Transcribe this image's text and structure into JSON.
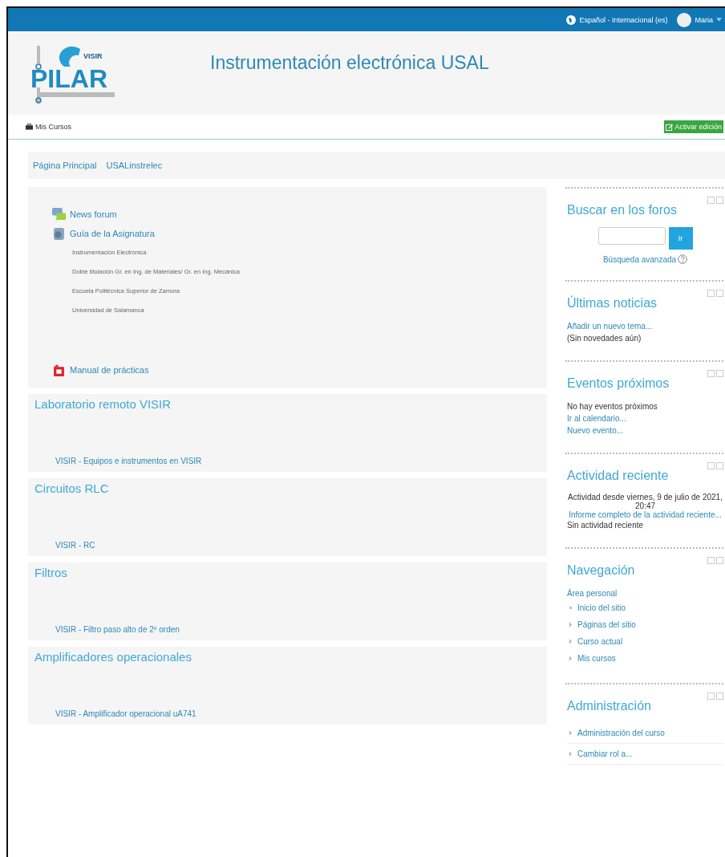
{
  "topbar": {
    "language": "Español - Internacional (es)",
    "user": "Maria"
  },
  "header": {
    "logo_text": "PILAR",
    "logo_badge": "VISIR",
    "title": "Instrumentación electrónica USAL"
  },
  "navbar": {
    "my_courses": "Mis Cursos",
    "edit_button": "Activar edición"
  },
  "breadcrumb": [
    "Página Principal",
    "USALinstrelec"
  ],
  "sections": [
    {
      "items": [
        {
          "kind": "forum",
          "text": "News forum"
        },
        {
          "kind": "resource",
          "text": "Guía de la Asignatura"
        },
        {
          "kind": "note",
          "text": "Instrumentación Electrónica"
        },
        {
          "kind": "note",
          "text": "Doble titulación Gr. en Ing. de Materiales/ Gr. en Ing. Mecánica"
        },
        {
          "kind": "note",
          "text": "Escuela Politécnica Superior de Zamora"
        },
        {
          "kind": "note",
          "text": "Universidad de Salamanca"
        },
        {
          "kind": "pdf",
          "text": "Manual de prácticas"
        }
      ]
    },
    {
      "title": "Laboratorio remoto VISIR",
      "items": [
        {
          "kind": "lab",
          "text": "VISIR - Equipos e instrumentos en VISIR"
        }
      ]
    },
    {
      "title": "Circuitos RLC",
      "items": [
        {
          "kind": "lab",
          "text": "VISIR - RC"
        }
      ]
    },
    {
      "title": "Filtros",
      "items": [
        {
          "kind": "lab",
          "text": "VISIR - Filtro paso alto de 2º orden"
        }
      ]
    },
    {
      "title": "Amplificadores operacionales",
      "items": [
        {
          "kind": "lab",
          "text": "VISIR - Amplificador operacional uA741"
        }
      ]
    }
  ],
  "blocks": [
    {
      "title": "Buscar en los foros",
      "lines": [
        {
          "kind": "search",
          "button": "Ir"
        },
        {
          "kind": "help_link",
          "text": "Búsqueda avanzada"
        }
      ]
    },
    {
      "title": "Últimas noticias",
      "lines": [
        {
          "kind": "link",
          "text": "Añadir un nuevo tema..."
        },
        {
          "kind": "text",
          "text": "(Sin novedades aún)"
        }
      ]
    },
    {
      "title": "Eventos próximos",
      "lines": [
        {
          "kind": "text",
          "text": "No hay eventos próximos"
        },
        {
          "kind": "link",
          "text": "Ir al calendario..."
        },
        {
          "kind": "link",
          "text": "Nuevo evento..."
        }
      ]
    },
    {
      "title": "Actividad reciente",
      "lines": [
        {
          "kind": "center_text",
          "text": "Actividad desde viernes, 9 de julio de 2021, 20:47"
        },
        {
          "kind": "center_link",
          "text": "Informe completo de la actividad reciente..."
        },
        {
          "kind": "text",
          "text": "Sin actividad reciente"
        }
      ]
    },
    {
      "title": "Navegación",
      "lines": [
        {
          "kind": "link",
          "text": "Área personal"
        },
        {
          "kind": "bullet",
          "text": "Inicio del sitio"
        },
        {
          "kind": "arrow",
          "text": "Páginas del sitio"
        },
        {
          "kind": "arrow",
          "text": "Curso actual"
        },
        {
          "kind": "arrow",
          "text": "Mis cursos"
        }
      ]
    },
    {
      "title": "Administración",
      "lines": [
        {
          "kind": "arrow_row",
          "text": "Administración del curso"
        },
        {
          "kind": "arrow_row",
          "text": "Cambiar rol a..."
        }
      ]
    }
  ]
}
